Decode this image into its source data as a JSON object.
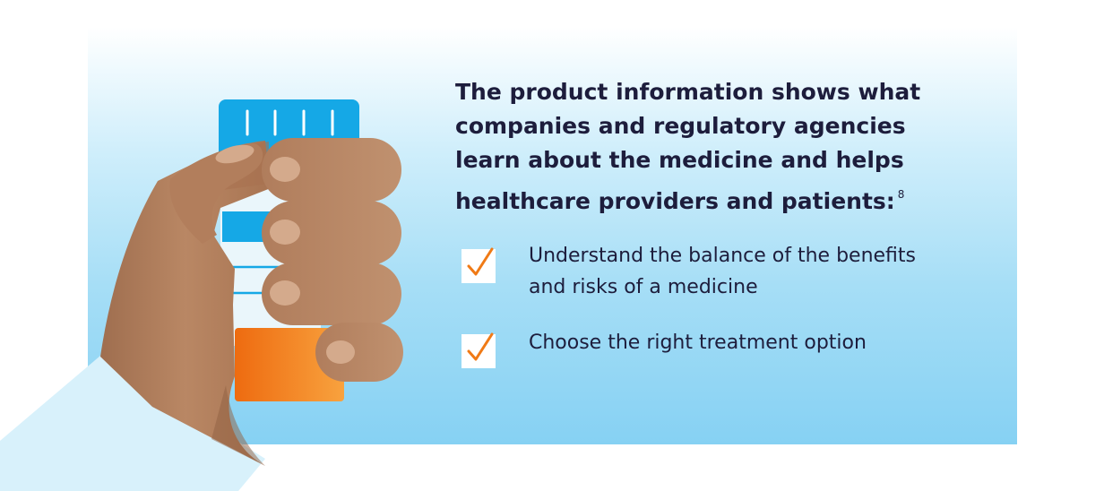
{
  "heading": {
    "text": "The product information shows what companies and regulatory agencies learn about the medicine and helps healthcare providers and patients:",
    "footnote": "8"
  },
  "benefits": [
    {
      "label": "Understand the balance of the benefits and risks of a medicine",
      "icon": "checkmark-icon"
    },
    {
      "label": "Choose the right treatment option",
      "icon": "checkmark-icon"
    }
  ],
  "colors": {
    "panel_top": "#ffffff",
    "panel_bottom": "#86d1f3",
    "text": "#1d1d3c",
    "check": "#f07a16",
    "cap": "#15a8e6",
    "label_orange": "#f2781a",
    "skin": "#b88462",
    "sleeve": "#d8f1fb"
  }
}
